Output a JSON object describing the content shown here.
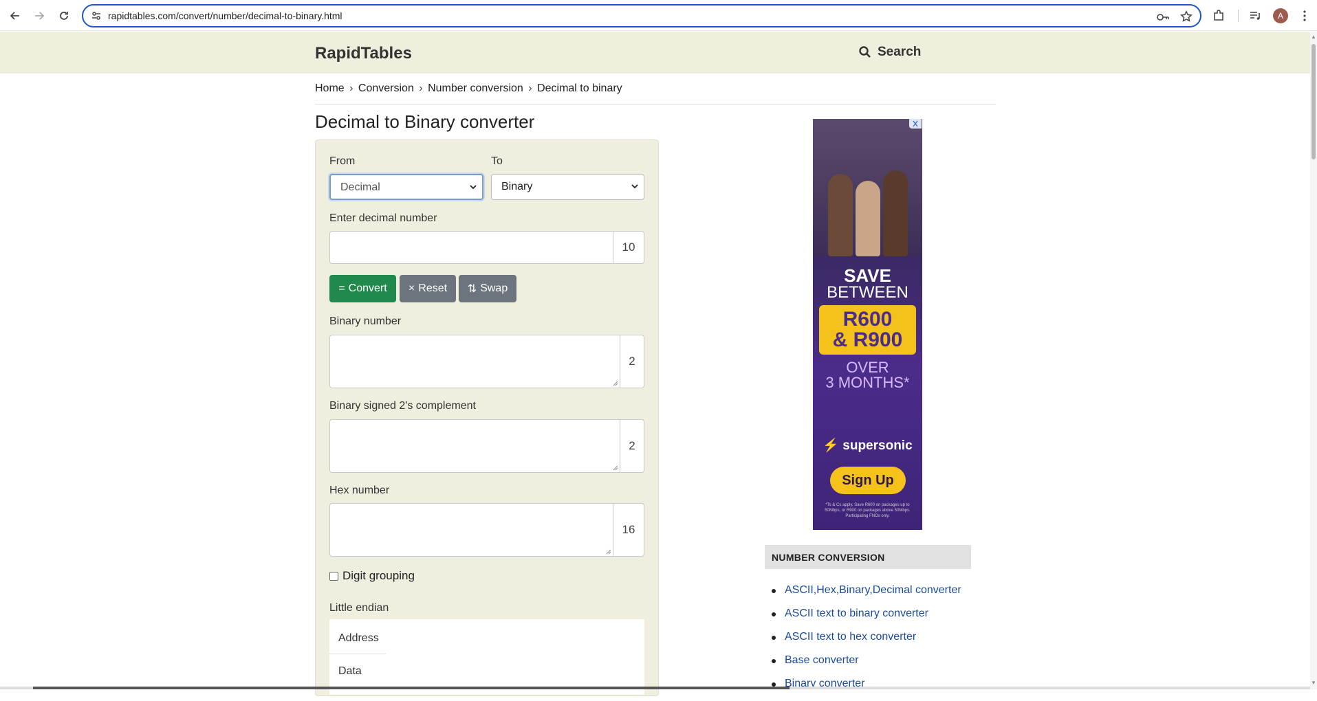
{
  "browser": {
    "url": "rapidtables.com/convert/number/decimal-to-binary.html",
    "avatar_letter": "A"
  },
  "site": {
    "logo": "RapidTables",
    "search_label": "Search"
  },
  "breadcrumb": {
    "items": [
      "Home",
      "Conversion",
      "Number conversion",
      "Decimal to binary"
    ],
    "separator": "›"
  },
  "page": {
    "title": "Decimal to Binary converter"
  },
  "converter": {
    "from_label": "From",
    "to_label": "To",
    "from_value": "Decimal",
    "to_value": "Binary",
    "input_label": "Enter decimal number",
    "input_value": "",
    "input_base": "10",
    "buttons": {
      "convert": "Convert",
      "convert_glyph": "=",
      "reset": "Reset",
      "reset_glyph": "×",
      "swap": "Swap",
      "swap_glyph": "⇅"
    },
    "binary_label": "Binary number",
    "binary_value": "",
    "binary_base": "2",
    "signed_label": "Binary signed 2's complement",
    "signed_value": "",
    "signed_base": "2",
    "hex_label": "Hex number",
    "hex_value": "",
    "hex_base": "16",
    "digit_grouping_label": "Digit grouping",
    "digit_grouping_checked": false,
    "little_endian_label": "Little endian",
    "endian_rows": [
      "Address",
      "Data"
    ]
  },
  "ad": {
    "save": "SAVE",
    "between": "BETWEEN",
    "amount_1": "R600",
    "amount_2": "& R900",
    "over": "OVER",
    "months": "3 MONTHS*",
    "brand": "supersonic",
    "cta": "Sign Up",
    "fine_print": "*Ts & Cs apply. Save R600 on packages up to 50Mbps, or R900 on packages above 50Mbps. Participating FNOs only."
  },
  "sidebar": {
    "heading": "NUMBER CONVERSION",
    "links": [
      "ASCII,Hex,Binary,Decimal converter",
      "ASCII text to binary converter",
      "ASCII text to hex converter",
      "Base converter",
      "Binary converter"
    ]
  },
  "colors": {
    "header_bg": "#f0eedc",
    "panel_bg": "#efeedf",
    "convert_green": "#1f8a4c",
    "gray_button": "#6c757d",
    "link_blue": "#1a4a9a",
    "ad_purple": "#4b2c8a",
    "ad_yellow": "#f5c21b"
  }
}
